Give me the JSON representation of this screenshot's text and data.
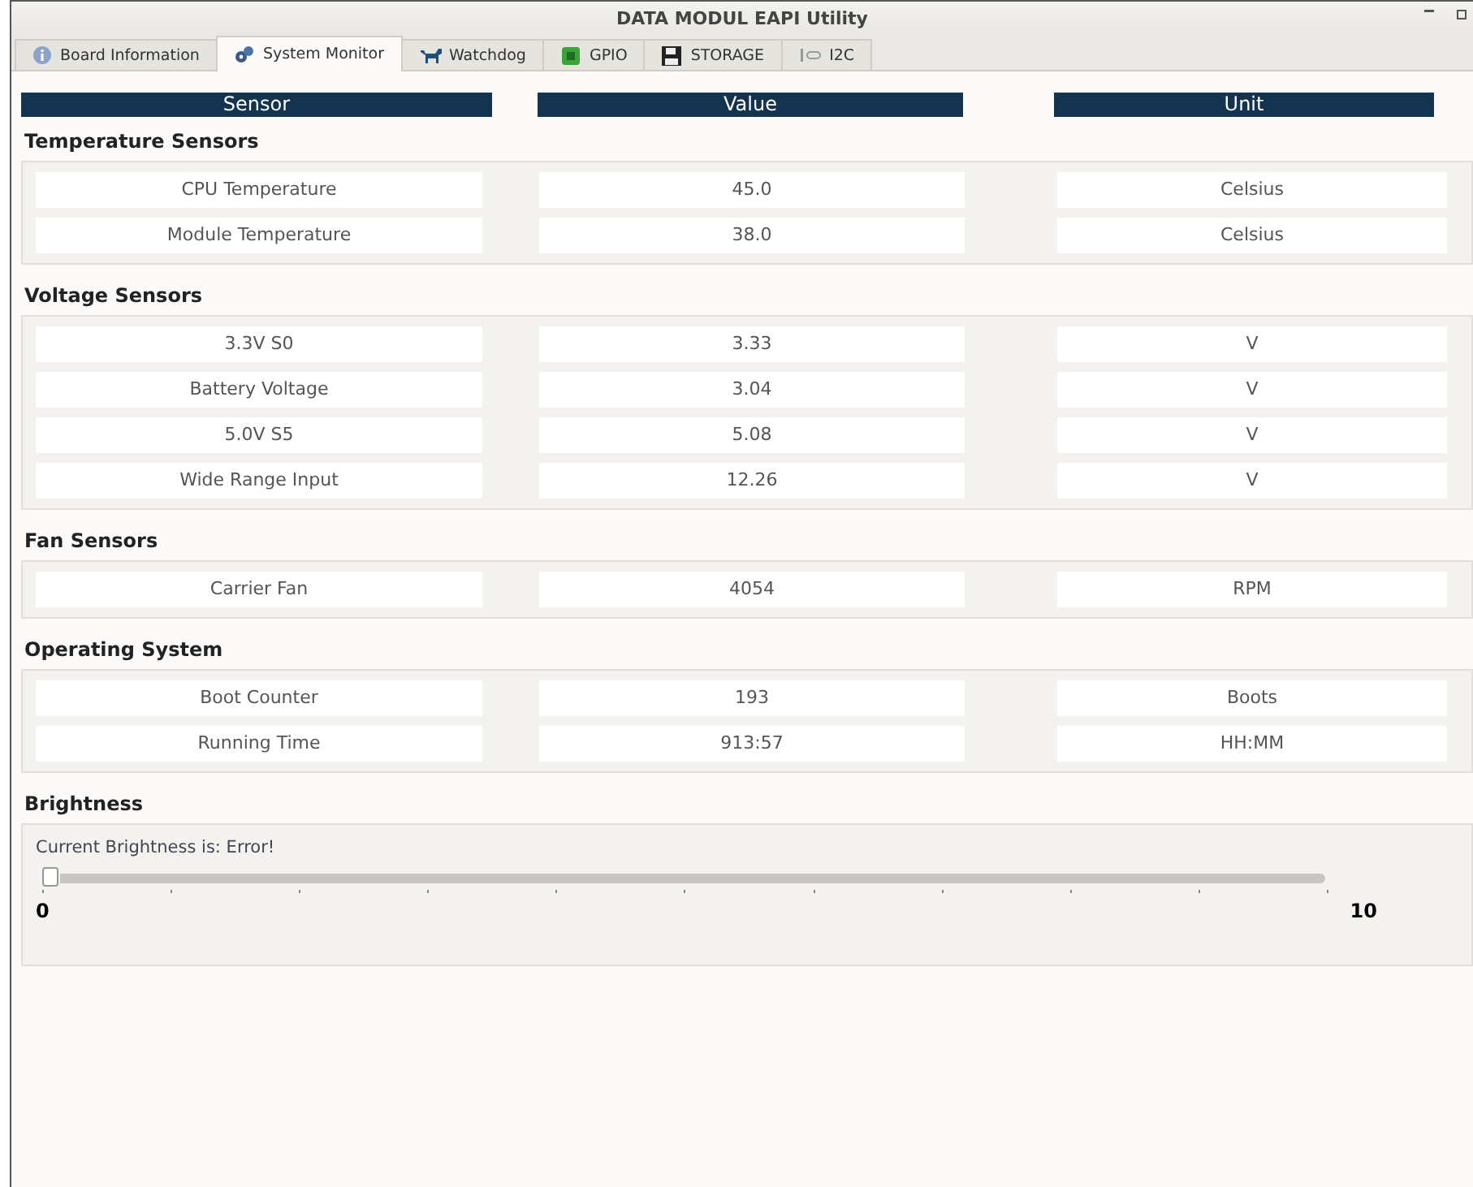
{
  "window": {
    "title": "DATA MODUL EAPI Utility"
  },
  "tabs": [
    {
      "label": "Board Information",
      "selected": false
    },
    {
      "label": "System Monitor",
      "selected": true
    },
    {
      "label": "Watchdog",
      "selected": false
    },
    {
      "label": "GPIO",
      "selected": false
    },
    {
      "label": "STORAGE",
      "selected": false
    },
    {
      "label": "I2C",
      "selected": false
    }
  ],
  "table": {
    "columns": [
      "Sensor",
      "Value",
      "Unit"
    ],
    "sections": [
      {
        "title": "Temperature Sensors",
        "rows": [
          [
            "CPU Temperature",
            "45.0",
            "Celsius"
          ],
          [
            "Module Temperature",
            "38.0",
            "Celsius"
          ]
        ]
      },
      {
        "title": "Voltage Sensors",
        "rows": [
          [
            "3.3V S0",
            "3.33",
            "V"
          ],
          [
            "Battery Voltage",
            "3.04",
            "V"
          ],
          [
            "5.0V S5",
            "5.08",
            "V"
          ],
          [
            "Wide Range Input",
            "12.26",
            "V"
          ]
        ]
      },
      {
        "title": "Fan Sensors",
        "rows": [
          [
            "Carrier Fan",
            "4054",
            "RPM"
          ]
        ]
      },
      {
        "title": "Operating System",
        "rows": [
          [
            "Boot Counter",
            "193",
            "Boots"
          ],
          [
            "Running Time",
            "913:57",
            "HH:MM"
          ]
        ]
      }
    ]
  },
  "brightness": {
    "title": "Brightness",
    "status": "Current Brightness is: Error!",
    "level": 0,
    "min_label": "0",
    "max_label": "10"
  }
}
